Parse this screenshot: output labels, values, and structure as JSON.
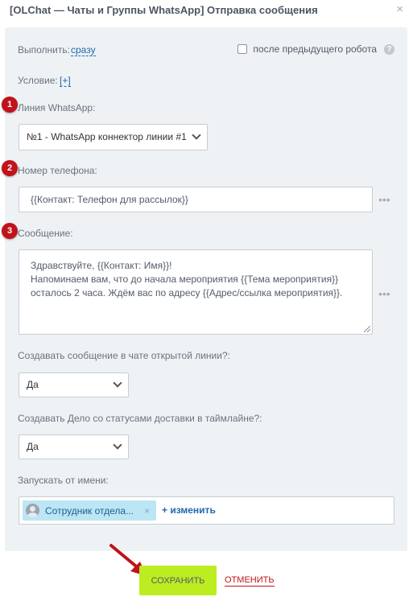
{
  "header": {
    "title": "[OLChat — Чаты и Группы WhatsApp] Отправка сообщения",
    "close_icon": "×"
  },
  "form": {
    "execute": {
      "label": "Выполнить:",
      "value": "сразу"
    },
    "after_previous": {
      "label": "после предыдущего робота",
      "checked": false,
      "help_icon": "?"
    },
    "condition": {
      "label": "Условие:",
      "add_link": "[+]"
    },
    "line": {
      "badge": "1",
      "label": "Линия WhatsApp:",
      "selected": "№1 - WhatsApp коннектор линии #1"
    },
    "phone": {
      "badge": "2",
      "label": "Номер телефона:",
      "value": "{{Контакт: Телефон для рассылок}}"
    },
    "message": {
      "badge": "3",
      "label": "Сообщение:",
      "lines": [
        "Здравствуйте, {{Контакт: Имя}}!",
        "Напоминаем вам, что до начала мероприятия {{Тема мероприятия}}",
        "осталось 2 часа. Ждём вас по адресу {{Адрес/ссылка мероприятия}}."
      ]
    },
    "create_message": {
      "label": "Создавать сообщение в чате открытой линии?:",
      "selected": "Да"
    },
    "create_task": {
      "label": "Создавать Дело со статусами доставки в таймлайне?:",
      "selected": "Да"
    },
    "run_as": {
      "label": "Запускать от имени:",
      "user": "Сотрудник отдела...",
      "remove_icon": "×",
      "change_link": "+ изменить"
    }
  },
  "footer": {
    "save_label": "СОХРАНИТЬ",
    "cancel_label": "ОТМЕНИТЬ"
  },
  "colors": {
    "accent": "#2067b0",
    "badge": "#c0131a",
    "save": "#bbed21",
    "panel": "#eef2f4"
  }
}
